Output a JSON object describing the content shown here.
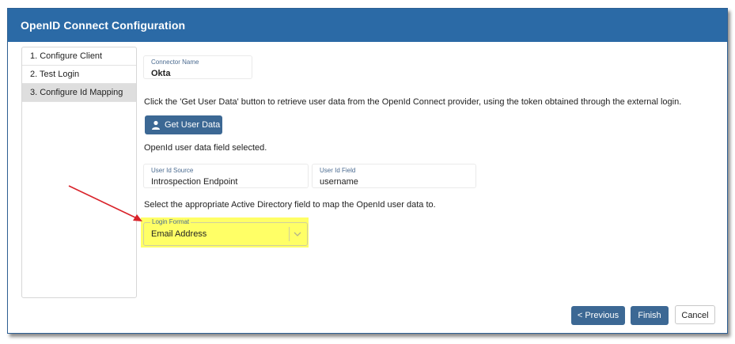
{
  "dialog": {
    "title": "OpenID Connect Configuration"
  },
  "steps": [
    {
      "label": "1. Configure Client",
      "active": false
    },
    {
      "label": "2. Test Login",
      "active": false
    },
    {
      "label": "3. Configure Id Mapping",
      "active": true
    }
  ],
  "connector": {
    "label": "Connector Name",
    "value": "Okta"
  },
  "instructions": {
    "get_user_data": "Click the 'Get User Data' button to retrieve user data from the OpenId Connect provider, using the token obtained through the external login.",
    "field_selected": "OpenId user data field selected.",
    "map_field": "Select the appropriate Active Directory field to map the OpenId user data to."
  },
  "get_user_data_button": {
    "label": "Get User Data",
    "icon": "user-icon"
  },
  "user_id_source": {
    "label": "User Id Source",
    "value": "Introspection Endpoint"
  },
  "user_id_field": {
    "label": "User Id Field",
    "value": "username"
  },
  "login_format": {
    "label": "Login Format",
    "value": "Email Address"
  },
  "footer": {
    "previous_label": "< Previous",
    "finish_label": "Finish",
    "cancel_label": "Cancel"
  },
  "colors": {
    "titlebar": "#2b6aa6",
    "primary_button": "#3c6894",
    "highlight": "#ffff66",
    "annotation_arrow": "#d9232a"
  }
}
